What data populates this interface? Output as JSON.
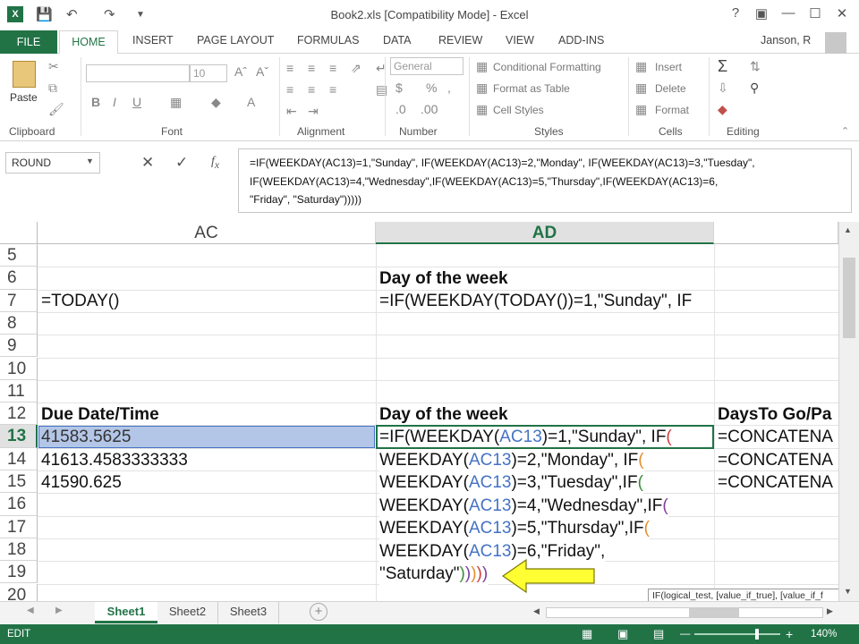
{
  "app": {
    "title": "Book2.xls  [Compatibility Mode] - Excel",
    "user": "Janson, R"
  },
  "tabs": [
    "FILE",
    "HOME",
    "INSERT",
    "PAGE LAYOUT",
    "FORMULAS",
    "DATA",
    "REVIEW",
    "VIEW",
    "ADD-INS"
  ],
  "ribbon": {
    "clipboard": {
      "paste": "Paste",
      "label": "Clipboard"
    },
    "font": {
      "size": "10",
      "label": "Font"
    },
    "alignment": {
      "label": "Alignment"
    },
    "number": {
      "format": "General",
      "label": "Number"
    },
    "styles": {
      "cond": "Conditional Formatting",
      "table": "Format as Table",
      "cell": "Cell Styles",
      "label": "Styles"
    },
    "cells": {
      "insert": "Insert",
      "delete": "Delete",
      "format": "Format",
      "label": "Cells"
    },
    "editing": {
      "label": "Editing"
    }
  },
  "name_box": "ROUND",
  "formula_bar": {
    "line1": "=IF(WEEKDAY(AC13)=1,\"Sunday\", IF(WEEKDAY(AC13)=2,\"Monday\", IF(WEEKDAY(AC13)=3,\"Tuesday\",",
    "line2": "IF(WEEKDAY(AC13)=4,\"Wednesday\",IF(WEEKDAY(AC13)=5,\"Thursday\",IF(WEEKDAY(AC13)=6,",
    "line3": "\"Friday\", \"Saturday\")))))"
  },
  "columns": [
    "AC",
    "AD"
  ],
  "rows": [
    "5",
    "6",
    "7",
    "8",
    "9",
    "10",
    "11",
    "12",
    "13",
    "14",
    "15",
    "16",
    "17",
    "18",
    "19",
    "20"
  ],
  "cells": {
    "AD6": "Day of the week",
    "AC7": "=TODAY()",
    "AD7": "=IF(WEEKDAY(TODAY())=1,\"Sunday\", IF",
    "AC12": "Due Date/Time",
    "AD12": "Day of the week",
    "AE12": "DaysTo Go/Pa",
    "AC13": "41583.5625",
    "AC14": "41613.4583333333",
    "AC15": "41590.625",
    "AE13": "=CONCATENA",
    "AE14": "=CONCATENA",
    "AE15": "=CONCATENA"
  },
  "edit": {
    "l1a": "=IF(WEEKDAY(",
    "l1ref": "AC13",
    "l1b": ")=1,\"Sunday\", IF",
    "l2a": "WEEKDAY(",
    "ref": "AC13",
    "l2b": ")=2,\"Monday\", IF",
    "l3b": ")=3,\"Tuesday\",IF",
    "l4b": ")=4,\"Wednesday\",IF",
    "l5b": ")=5,\"Thursday\",IF",
    "l6b": ")=6,\"Friday\",",
    "l7a": "\"Saturday\""
  },
  "tooltip": "IF(logical_test, [value_if_true], [value_if_f",
  "sheets": [
    "Sheet1",
    "Sheet2",
    "Sheet3"
  ],
  "status": {
    "mode": "EDIT",
    "zoom": "140%"
  }
}
